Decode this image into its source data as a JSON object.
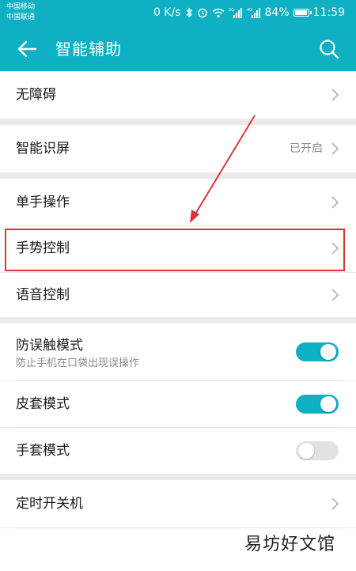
{
  "status_bar": {
    "carrier_1": "中国移动",
    "carrier_2": "中国联通",
    "speed": "0 K/s",
    "battery": "84%",
    "time": "11:59",
    "battery_level": 0.84
  },
  "toolbar": {
    "title": "智能辅助",
    "back_icon": "back-arrow-icon",
    "search_icon": "search-icon"
  },
  "items": {
    "accessibility": {
      "label": "无障碍"
    },
    "smart_screen": {
      "label": "智能识屏",
      "value": "已开启"
    },
    "one_hand": {
      "label": "单手操作"
    },
    "gesture": {
      "label": "手势控制"
    },
    "voice": {
      "label": "语音控制"
    },
    "anti_touch": {
      "label": "防误触模式",
      "desc": "防止手机在口袋出现误操作",
      "enabled": true
    },
    "cover_mode": {
      "label": "皮套模式",
      "enabled": true
    },
    "glove_mode": {
      "label": "手套模式",
      "enabled": false
    },
    "scheduled_power": {
      "label": "定时开关机"
    }
  },
  "annotation": {
    "color": "#d9343c"
  },
  "watermark": "易坊好文馆",
  "colors": {
    "accent": "#0fb0c3",
    "background": "#ebebeb"
  }
}
